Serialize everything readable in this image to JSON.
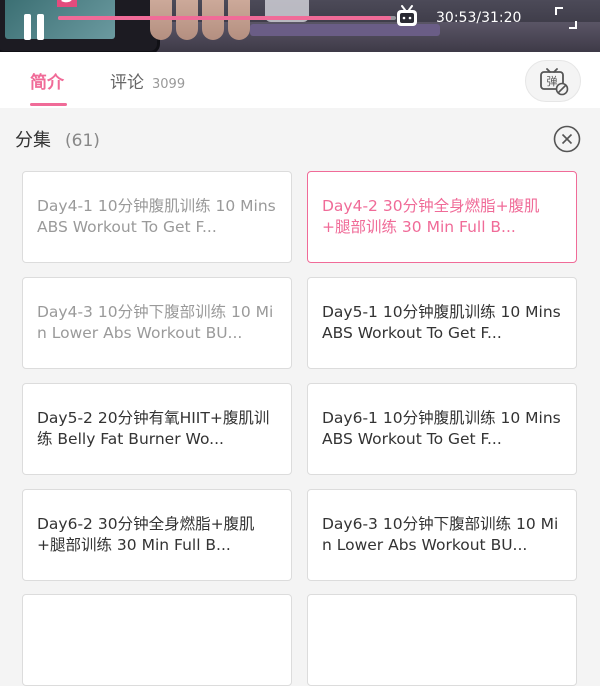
{
  "player": {
    "time": "30:53/31:20",
    "progress_fraction": 0.985,
    "thumbnail_badge": "5"
  },
  "tabs": {
    "intro_label": "简介",
    "comments_label": "评论",
    "comments_count": "3099",
    "danmaku_label": "弹"
  },
  "episodes": {
    "title": "分集",
    "count": "(61)",
    "items": [
      {
        "text": "Day4-1  10分钟腹肌训练  10 Mins ABS Workout To Get F...",
        "state": "watched"
      },
      {
        "text": "Day4-2  30分钟全身燃脂+腹肌+腿部训练  30 Min Full B...",
        "state": "active"
      },
      {
        "text": "Day4-3  10分钟下腹部训练 10 Min Lower Abs Workout BU...",
        "state": "watched"
      },
      {
        "text": "Day5-1   10分钟腹肌训练 10 Mins ABS Workout To Get F...",
        "state": "normal"
      },
      {
        "text": "Day5-2   20分钟有氧HIIT+腹肌训练  Belly Fat Burner Wo...",
        "state": "normal"
      },
      {
        "text": "Day6-1  10分钟腹肌训练  10 Mins ABS Workout To Get F...",
        "state": "normal"
      },
      {
        "text": "Day6-2  30分钟全身燃脂+腹肌+腿部训练   30 Min Full B...",
        "state": "normal"
      },
      {
        "text": "Day6-3  10分钟下腹部训练 10 Min Lower Abs Workout BU...",
        "state": "normal"
      }
    ]
  },
  "colors": {
    "accent": "#f06b98",
    "text": "#333333",
    "muted": "#9a9a9a"
  },
  "icons": [
    "pause-icon",
    "tv-icon",
    "fullscreen-icon",
    "danmaku-off-icon",
    "close-icon"
  ]
}
